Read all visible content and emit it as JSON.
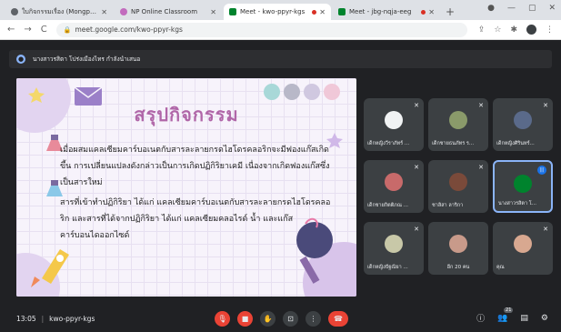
{
  "browser": {
    "tabs": [
      {
        "label": "ใบกิจกรรมเรื่อง (Mongpai School)",
        "favicon_color": "#5f6368",
        "active": false
      },
      {
        "label": "NP Online Classroom",
        "favicon_color": "#c26bbd",
        "active": false
      },
      {
        "label": "Meet - kwo-ppyr-kgs",
        "favicon_color": "#00832d",
        "active": true
      },
      {
        "label": "Meet - jbg-nqja-eeg",
        "favicon_color": "#00832d",
        "active": false
      }
    ],
    "new_tab": "+",
    "url": "meet.google.com/kwo-ppyr-kgs"
  },
  "notice": {
    "text": "นางสาวรสิตา โปร่งเมืองไทร กำลังนำเสนอ"
  },
  "slide": {
    "title": "สรุปกิจกรรม",
    "paragraphs": [
      "เมื่อผสมแคลเซียมคาร์บอเนตกับสารละลายกรดไฮโดรคลอริกจะมีฟองแก๊สเกิดขึ้น การเปลี่ยนแปลงดังกล่าวเป็นการเกิดปฏิกิริยาเคมี เนื่องจากเกิดฟองแก๊สซึ่งเป็นสารใหม่",
      "สารที่เข้าทำปฏิกิริยา ได้แก่ แคลเซียมคาร์บอเนตกับสารละลายกรดไฮโดรคลอริก และสารที่ได้จากปฏิกิริยา ได้แก่ แคลเซียมคลอไรด์ น้ำ และแก๊สคาร์บอนไดออกไซด์"
    ],
    "dot_colors": [
      "#a8d8d8",
      "#b8b8c8",
      "#d0c8e0",
      "#f0c8d8"
    ]
  },
  "participants": [
    {
      "name": "เด็กหญิงวีราภัทร์ ...",
      "avatar_color": "#f1f3f4"
    },
    {
      "name": "เด็กชายธนภัทร ร...",
      "avatar_color": "#8a9a6a"
    },
    {
      "name": "เด็กหญิงศิรินทร์...",
      "avatar_color": "#5a6a8a"
    },
    {
      "name": "เด็กชายกิตติภณ ...",
      "avatar_color": "#c86a6a"
    },
    {
      "name": "ชาลิสา ลาริกา",
      "avatar_color": "#7a4a3a"
    },
    {
      "name": "นางสาวรสิตา โ...",
      "avatar_color": "#00832d"
    },
    {
      "name": "เด็กหญิงปัฐณิยา ...",
      "avatar_color": "#c8c8a8"
    },
    {
      "name": "อีก 20 คน",
      "avatar_color": "#c89a8a"
    },
    {
      "name": "คุณ",
      "avatar_color": "#d8a890"
    }
  ],
  "meeting": {
    "time": "13:05",
    "code": "kwo-ppyr-kgs",
    "participant_count": "21"
  },
  "colors": {
    "accent": "#8ab4f8",
    "danger": "#ea4335",
    "title": "#b066a8"
  }
}
